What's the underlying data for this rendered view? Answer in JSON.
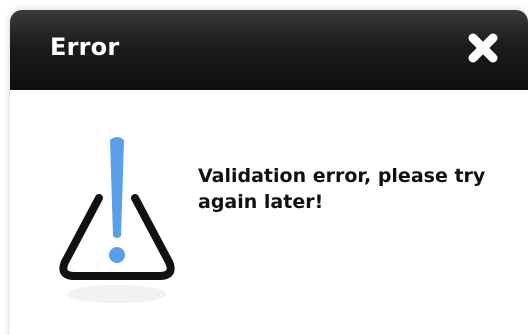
{
  "dialog": {
    "title": "Error",
    "message": "Validation error, please try again later!",
    "close_icon": "close-icon",
    "warning_icon": "warning-icon"
  },
  "colors": {
    "titlebar": "#111111",
    "title_text": "#ffffff",
    "exclamation": "#5b9ee9",
    "triangle_stroke": "#111111",
    "message_text": "#111111"
  }
}
